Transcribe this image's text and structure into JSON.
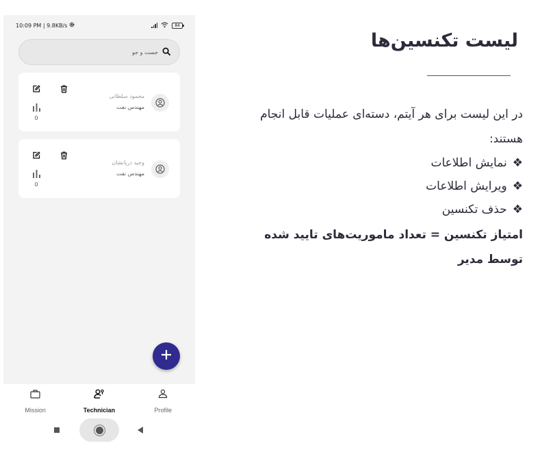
{
  "status_bar": {
    "time_speed": "10:09 PM | 9.8KB/s",
    "battery": "84"
  },
  "search": {
    "placeholder": "جست و جو"
  },
  "technicians": [
    {
      "name": "محمود سلطانی",
      "role": "مهندس نفت",
      "score": "0"
    },
    {
      "name": "وحید دریانشان",
      "role": "مهندس نفت",
      "score": "0"
    }
  ],
  "bottom_nav": {
    "items": [
      {
        "label": "Mission",
        "icon": "briefcase-icon"
      },
      {
        "label": "Technician",
        "icon": "technician-icon",
        "active": true
      },
      {
        "label": "Profile",
        "icon": "person-icon"
      }
    ]
  },
  "panel": {
    "title": "لیست تکنسین‌ها",
    "intro": "در این لیست برای هر آیتم، دسته‌ای عملیات قابل انجام هستند:",
    "bullet_symbol": "❖",
    "bullets": [
      "نمایش اطلاعات",
      "ویرایش اطلاعات",
      "حذف تکنسین"
    ],
    "note": "امتیاز تکنسین = تعداد ماموریت‌های تایید شده توسط مدیر"
  },
  "colors": {
    "accent": "#2f2b8f",
    "text": "#2b2b3a",
    "card_bg": "#ffffff",
    "screen_bg": "#f3f3f3"
  }
}
